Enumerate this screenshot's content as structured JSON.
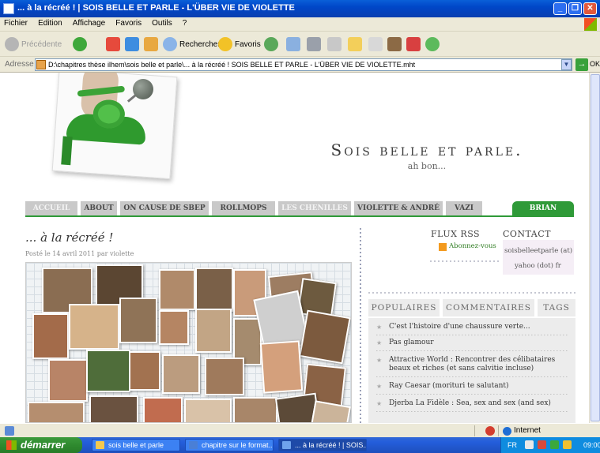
{
  "window": {
    "title": "... à la récréé ! | SOIS BELLE ET PARLE - L'ÜBER VIE DE VIOLETTE",
    "buttons": [
      "_",
      "❐",
      "✕"
    ]
  },
  "menubar": [
    "Fichier",
    "Edition",
    "Affichage",
    "Favoris",
    "Outils",
    "?"
  ],
  "toolbar": {
    "back_label": "Précédente",
    "search_label": "Rechercher",
    "favorites_label": "Favoris"
  },
  "address": {
    "label": "Adresse",
    "value": "D:\\chapitres thèse ilhem\\sois belle et parle\\... à la récréé ! SOIS BELLE ET PARLE - L'ÜBER VIE DE VIOLETTE.mht",
    "go_label": "OK"
  },
  "site": {
    "title": "Sois belle et parle.",
    "subtitle": "ah bon..."
  },
  "nav": [
    "ACCUEIL",
    "ABOUT",
    "ON CAUSE DE SBEP",
    "ROLLMOPS",
    "LES CHENILLES",
    "VIOLETTE & ANDRÉ",
    "VAZI",
    "BRIAN"
  ],
  "post": {
    "title": "... à la récréé !",
    "meta": "Posté le 14 avril 2011 par violette"
  },
  "sidebar": {
    "rss_heading": "FLUX RSS",
    "rss_link": "Abonnez-vous",
    "contact_heading": "CONTACT",
    "contact_lines": [
      "soisbelleetparle (at)",
      "yahoo (dot) fr"
    ],
    "tabs": [
      "POPULAIRES",
      "COMMENTAIRES",
      "TAGS"
    ],
    "popular": [
      "C'est l'histoire d'une chaussure verte...",
      "Pas glamour",
      "Attractive World : Rencontrer des célibataires beaux et riches (et sans calvitie incluse)",
      "Ray Caesar (morituri te salutant)",
      "Djerba La Fidèle : Sea, sex and sex (and sex)"
    ]
  },
  "statusbar": {
    "zone": "Internet"
  },
  "taskbar": {
    "start_label": "démarrer",
    "tasks": [
      "sois belle et parle",
      "chapitre sur le format...",
      "... à la récréé ! | SOIS..."
    ],
    "lang": "FR",
    "clock": "09:00"
  },
  "colors": {
    "nav_bg": "#c9c9c9",
    "accent_green": "#2f9a38",
    "xp_blue": "#0a5fd8"
  }
}
